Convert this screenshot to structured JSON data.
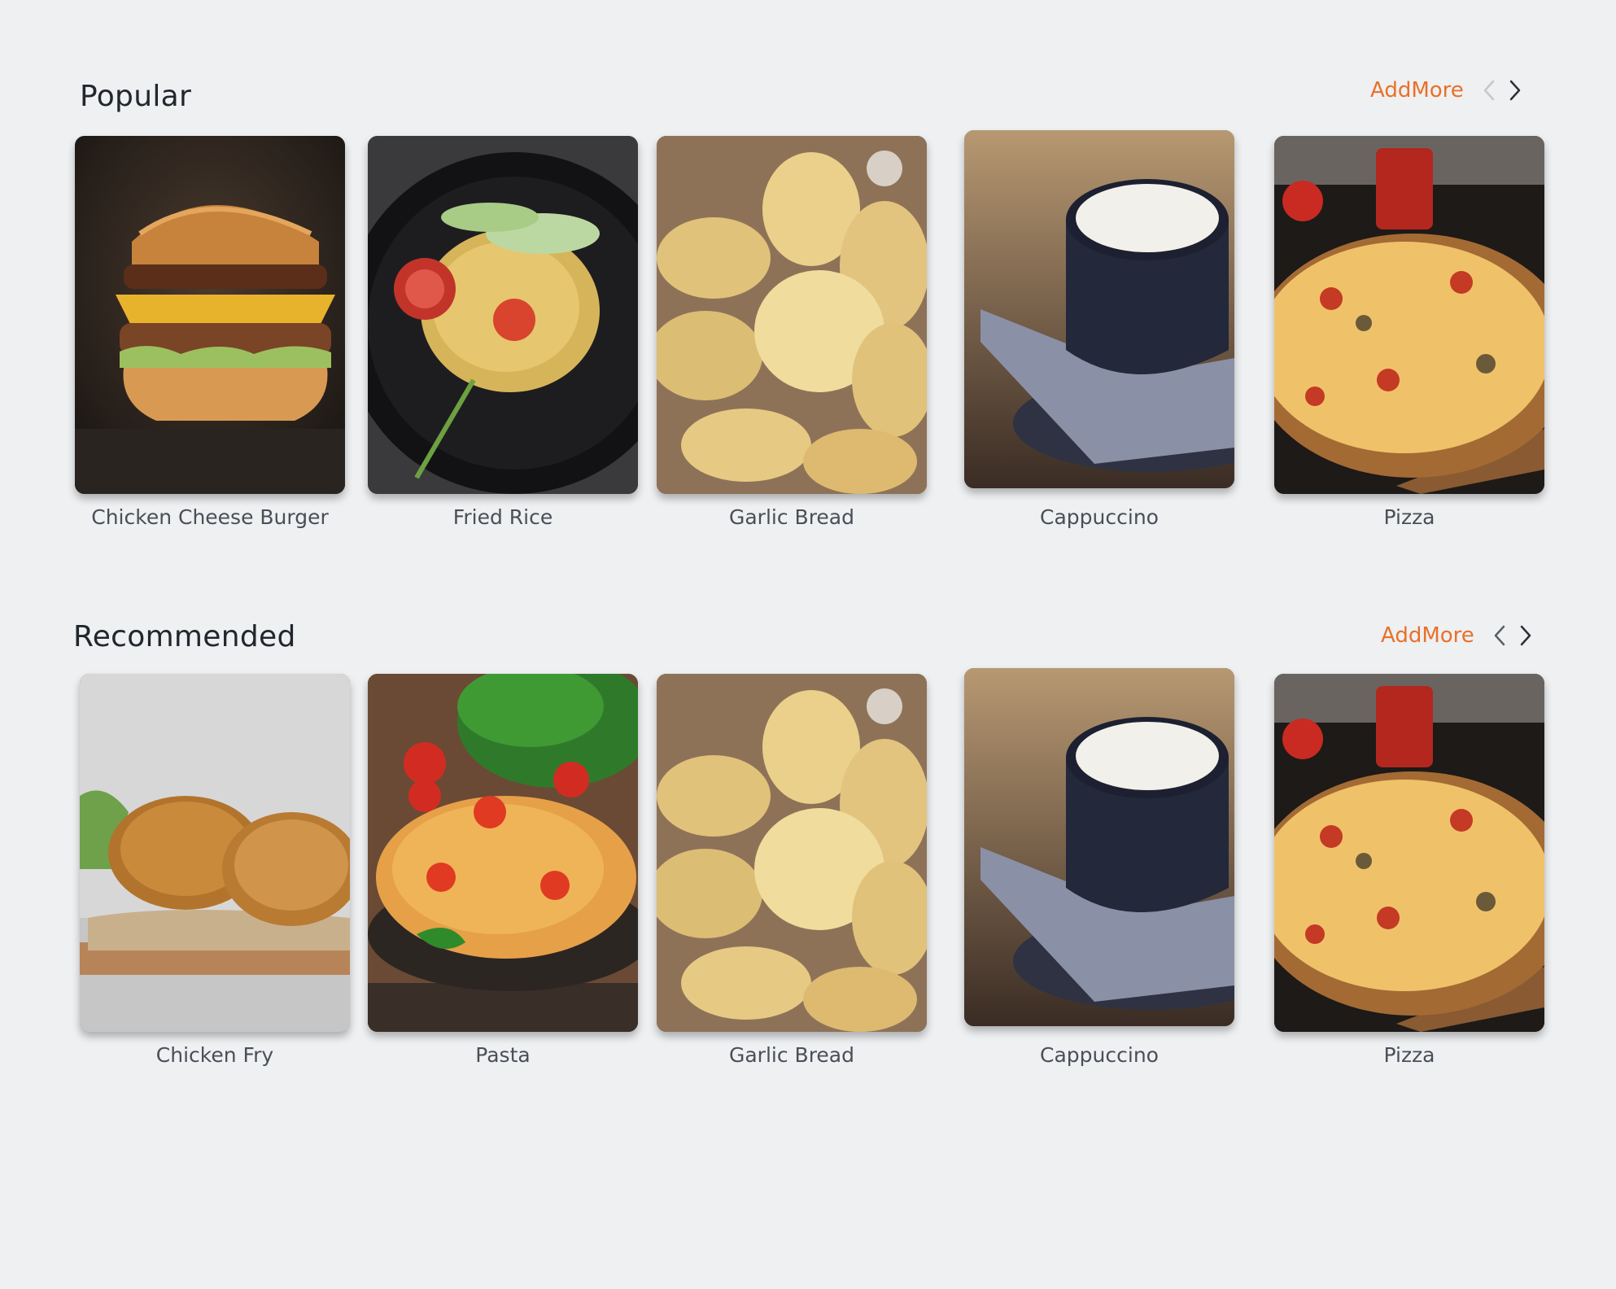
{
  "popular": {
    "title": "Popular",
    "add_more_label": "AddMore",
    "items": [
      {
        "label": "Chicken Cheese Burger",
        "image": "burger"
      },
      {
        "label": "Fried Rice",
        "image": "fried-rice"
      },
      {
        "label": "Garlic Bread",
        "image": "garlic-bread"
      },
      {
        "label": "Cappuccino",
        "image": "cappuccino"
      },
      {
        "label": "Pizza",
        "image": "pizza"
      }
    ]
  },
  "recommended": {
    "title": "Recommended",
    "add_more_label": "AddMore",
    "items": [
      {
        "label": "Chicken Fry",
        "image": "chicken-fry"
      },
      {
        "label": "Pasta",
        "image": "pasta"
      },
      {
        "label": "Garlic Bread",
        "image": "garlic-bread"
      },
      {
        "label": "Cappuccino",
        "image": "cappuccino"
      },
      {
        "label": "Pizza",
        "image": "pizza"
      }
    ]
  },
  "colors": {
    "background": "#eef0f2",
    "accent": "#e8712a",
    "title": "#22262d",
    "label": "#4a4f57"
  },
  "icons": {
    "prev": "chevron-left-icon",
    "next": "chevron-right-icon"
  }
}
